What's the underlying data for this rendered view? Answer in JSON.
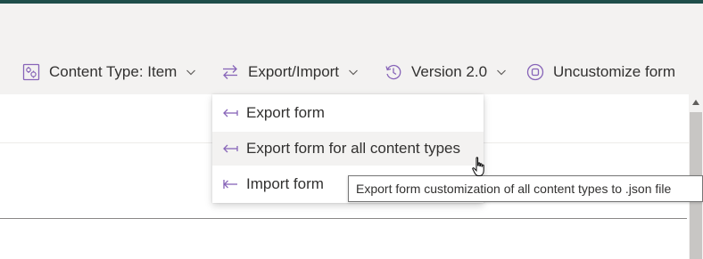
{
  "toolbar": {
    "content_type_label": "Content Type: Item",
    "export_import_label": "Export/Import",
    "version_label": "Version 2.0",
    "uncustomize_label": "Uncustomize form"
  },
  "menu": {
    "items": [
      {
        "label": "Export form",
        "icon": "export-arrow-icon"
      },
      {
        "label": "Export form for all content types",
        "icon": "export-arrow-icon"
      },
      {
        "label": "Import form",
        "icon": "import-arrow-icon"
      }
    ],
    "hovered_index": 1
  },
  "tooltip": {
    "text": "Export form customization of all content types to .json file"
  },
  "colors": {
    "accent": "#8764b8",
    "top_bar": "#1f4e4a",
    "toolbar_bg": "#f3f2f1",
    "hover_bg": "#f3f2f1"
  }
}
